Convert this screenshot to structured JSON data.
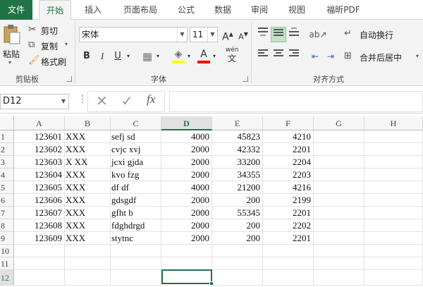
{
  "tabs": [
    "文件",
    "开始",
    "插入",
    "页面布局",
    "公式",
    "数据",
    "审阅",
    "视图",
    "福昕PDF"
  ],
  "clipboard": {
    "paste": "粘贴",
    "cut": "剪切",
    "copy": "复制",
    "format_painter": "格式刷",
    "label": "剪贴板"
  },
  "font": {
    "name": "宋体",
    "size": "11",
    "grow": "A",
    "shrink": "A",
    "bold": "B",
    "italic": "I",
    "underline": "U",
    "label": "字体",
    "phonetic": "wén"
  },
  "alignment": {
    "wrap": "自动换行",
    "merge": "合并后居中",
    "label": "对齐方式"
  },
  "formula_bar": {
    "name_box": "D12",
    "fx": "fx",
    "content": ""
  },
  "columns": [
    "A",
    "B",
    "C",
    "D",
    "E",
    "F",
    "G",
    "H"
  ],
  "selected_column": "D",
  "selected_row": "12",
  "rows": [
    {
      "n": "1",
      "a": "123601",
      "b": "XXX",
      "c": "sefj sd",
      "d": "4000",
      "e": "45823",
      "f": "4210"
    },
    {
      "n": "2",
      "a": "123602",
      "b": "XXX",
      "c": "cvjc xvj",
      "d": "2000",
      "e": "42332",
      "f": "2201"
    },
    {
      "n": "3",
      "a": "123603",
      "b": "X XX",
      "c": "jcxi gjda",
      "d": "2000",
      "e": "33200",
      "f": "2204"
    },
    {
      "n": "4",
      "a": "123604",
      "b": "XXX",
      "c": "kvo fzg",
      "d": "2000",
      "e": "34355",
      "f": "2203"
    },
    {
      "n": "5",
      "a": "123605",
      "b": "XXX",
      "c": "df df",
      "d": "4000",
      "e": "21200",
      "f": "4216"
    },
    {
      "n": "6",
      "a": "123606",
      "b": "XXX",
      "c": "gdsgdf",
      "d": "2000",
      "e": "200",
      "f": "2199"
    },
    {
      "n": "7",
      "a": "123607",
      "b": "XXX",
      "c": "gfht b",
      "d": "2000",
      "e": "55345",
      "f": "2201"
    },
    {
      "n": "8",
      "a": "123608",
      "b": "XXX",
      "c": "fdghdrgd",
      "d": "2000",
      "e": "200",
      "f": "2202"
    },
    {
      "n": "9",
      "a": "123609",
      "b": "XXX",
      "c": "stytnc",
      "d": "2000",
      "e": "200",
      "f": "2201"
    },
    {
      "n": "10",
      "a": "",
      "b": "",
      "c": "",
      "d": "",
      "e": "",
      "f": ""
    },
    {
      "n": "11",
      "a": "",
      "b": "",
      "c": "",
      "d": "",
      "e": "",
      "f": ""
    },
    {
      "n": "12",
      "a": "",
      "b": "",
      "c": "",
      "d": "",
      "e": "",
      "f": ""
    }
  ],
  "colors": {
    "accent": "#217346",
    "selected_align": "#c5e0c9",
    "highlight": "#ffff00",
    "font_color": "#ff0000"
  }
}
